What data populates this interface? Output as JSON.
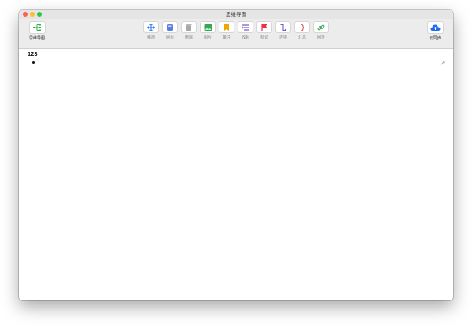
{
  "window": {
    "title": "思维导图",
    "traffic_lights": {
      "close": "#fe5f57",
      "minimize": "#febc2e",
      "zoom": "#28c840"
    }
  },
  "toolbar": {
    "left_button": {
      "label": "思维导图",
      "icon": "mindmap-icon",
      "color": "#2fb344"
    },
    "tools": [
      {
        "label": "移动",
        "icon": "move-icon",
        "color": "#3b82f6"
      },
      {
        "label": "网页",
        "icon": "webpage-icon",
        "color": "#5b7ee5"
      },
      {
        "label": "删除",
        "icon": "trash-icon",
        "color": "#9a9a9a"
      },
      {
        "label": "图片",
        "icon": "image-icon",
        "color": "#34a853"
      },
      {
        "label": "备注",
        "icon": "note-icon",
        "color": "#f0a500"
      },
      {
        "label": "收起",
        "icon": "collapse-icon",
        "color": "#7c5cc4"
      },
      {
        "label": "标记",
        "icon": "flag-icon",
        "color": "#e8334a"
      },
      {
        "label": "连接",
        "icon": "connect-icon",
        "color": "#6d5bd0"
      },
      {
        "label": "汇总",
        "icon": "summary-icon",
        "color": "#e0554f"
      },
      {
        "label": "网址",
        "icon": "link-icon",
        "color": "#34a853"
      }
    ],
    "right_button": {
      "label": "云同步",
      "icon": "cloud-upload-icon",
      "color": "#1d6bf3"
    }
  },
  "canvas": {
    "root_node": "123",
    "child_nodes": [
      ""
    ]
  }
}
